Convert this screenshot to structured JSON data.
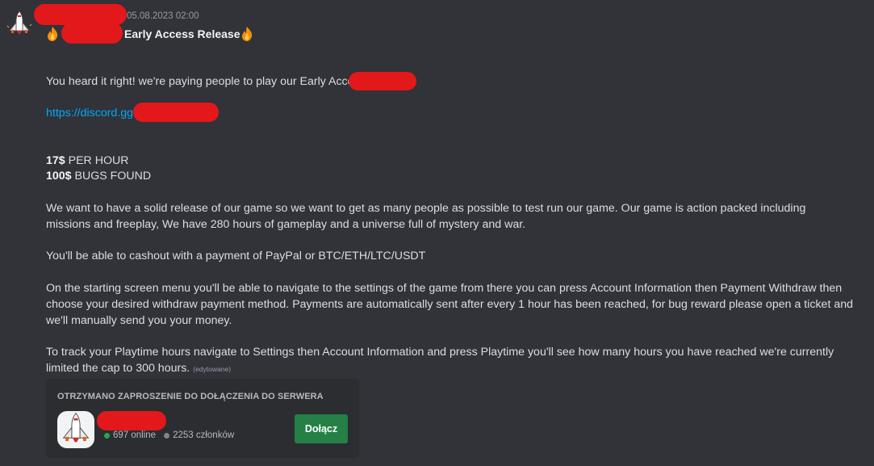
{
  "message": {
    "timestamp": "05.08.2023 02:00",
    "title": "Early Access Release",
    "title_emoji": "fire-emoji",
    "avatar_icon": "space-shuttle-icon",
    "line1": "You heard it right! we're paying people to play our Early Access",
    "link": "https://discord.gg",
    "rate1_bold": "17$",
    "rate1_text": " PER HOUR",
    "rate2_bold": "100$",
    "rate2_text": " BUGS FOUND",
    "para1": "We want to have a solid release of our game so we want to get as many people as possible to test run our game. Our game is action packed including missions and freeplay, We have 280 hours of gameplay and a universe full of mystery and war.",
    "para2": "You'll be able to cashout with a payment of PayPal or BTC/ETH/LTC/USDT",
    "para3": "On the starting screen menu you'll be able to navigate to the settings of the game from there you can press Account Information then Payment Withdraw then choose your desired withdraw payment method. Payments are automatically sent after every 1 hour has been reached, for bug reward please open a ticket and we'll manually send you your money.",
    "para4": "To track your Playtime hours navigate to Settings then Account Information and press Playtime you'll see how many hours you have reached we're currently limited the cap to 300 hours.",
    "edited_label": "(edytowane)"
  },
  "invite": {
    "heading": "OTRZYMANO ZAPROSZENIE DO DOŁĄCZENIA DO SERWERA",
    "icon": "space-shuttle-icon",
    "online": "697 online",
    "members": "2253 członków",
    "join_label": "Dołącz"
  },
  "colors": {
    "background": "#313338",
    "link": "#00a8fc",
    "join_button": "#248046",
    "online_dot": "#23a55a",
    "redaction": "#e3181b"
  }
}
